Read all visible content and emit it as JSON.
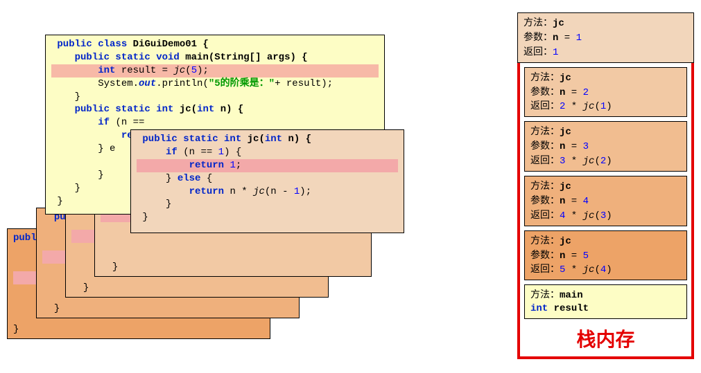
{
  "left": {
    "main_card": {
      "l1a": "public class",
      "l1b": "DiGuiDemo01 {",
      "l2a": "public static void",
      "l2b": "main(String[] args) {",
      "l3a": "int",
      "l3b": "result = ",
      "l3c": "jc",
      "l3d": "(",
      "l3e": "5",
      "l3f": ");",
      "l4a": "System.",
      "l4b": "out",
      "l4c": ".println(",
      "l4d": "\"5的阶乘是：\"",
      "l4e": "+ result);",
      "l5": "}",
      "l6a": "public static int",
      "l6b": "jc(",
      "l6c": "int",
      "l6d": "n) {",
      "l7a": "if",
      "l7b": "(n ==",
      "l8a": "ret",
      "l9a": "} e",
      "l10": "",
      "l11": "}",
      "l12": "}",
      "l13": "}"
    },
    "inner_card": {
      "l1a": "public static int",
      "l1b": "jc(",
      "l1c": "int",
      "l1d": "n) {",
      "l2a": "if",
      "l2b": "(n ==",
      "l2c": "1",
      "l2d": ") {",
      "l3a": "return",
      "l3b": "1",
      "l3c": ";",
      "l4a": "}",
      "l4b": "else",
      "l4c": "{",
      "l5a": "return",
      "l5b": "n * ",
      "l5c": "jc",
      "l5d": "(n - ",
      "l5e": "1",
      "l5f": ");",
      "l6": "}",
      "l7": "}"
    },
    "peek_publi": "publi",
    "peek_publ": "publ",
    "peek_pub": "pub",
    "brace": "}"
  },
  "stack": {
    "title": "栈内存",
    "method_label": "方法：",
    "param_label": "参数：",
    "return_label": "返回：",
    "frames": [
      {
        "method": "jc",
        "param_name": "n",
        "param_eq": " = ",
        "param_val": "1",
        "ret_full": "1",
        "ret_prefix_num": "1",
        "ret_star": "",
        "ret_call": "",
        "ret_arg": ""
      },
      {
        "method": "jc",
        "param_name": "n",
        "param_eq": " = ",
        "param_val": "2",
        "ret_prefix_num": "2",
        "ret_star": " * ",
        "ret_call": "jc",
        "ret_arg": "1"
      },
      {
        "method": "jc",
        "param_name": "n",
        "param_eq": " = ",
        "param_val": "3",
        "ret_prefix_num": "3",
        "ret_star": " * ",
        "ret_call": "jc",
        "ret_arg": "2"
      },
      {
        "method": "jc",
        "param_name": "n",
        "param_eq": " = ",
        "param_val": "4",
        "ret_prefix_num": "4",
        "ret_star": " * ",
        "ret_call": "jc",
        "ret_arg": "3"
      },
      {
        "method": "jc",
        "param_name": "n",
        "param_eq": " = ",
        "param_val": "5",
        "ret_prefix_num": "5",
        "ret_star": " * ",
        "ret_call": "jc",
        "ret_arg": "4"
      }
    ],
    "main_frame": {
      "method": "main",
      "int_kw": "int",
      "var": " result"
    }
  }
}
